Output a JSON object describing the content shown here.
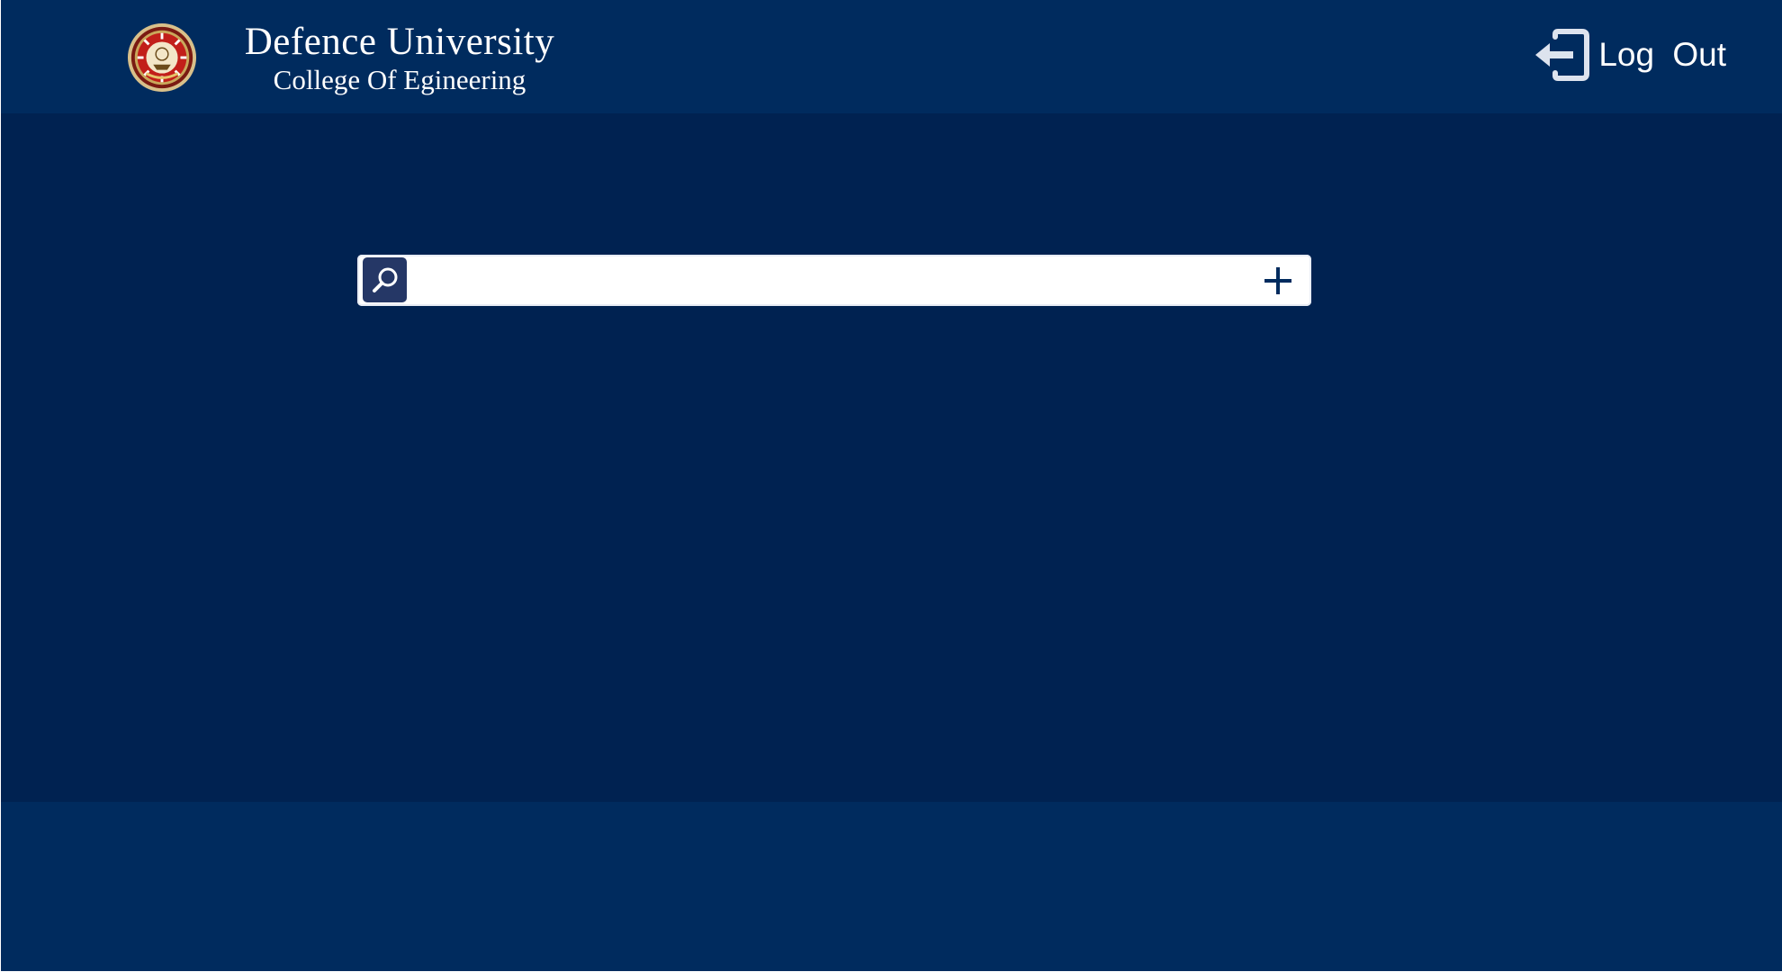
{
  "header": {
    "title": "Defence University",
    "subtitle": "College Of Egineering",
    "logo_icon": "university-seal-icon",
    "logout_label": "Log  Out",
    "logout_icon": "logout-arrow-icon"
  },
  "search": {
    "placeholder": "",
    "value": "",
    "search_icon": "search-icon",
    "add_icon": "plus-icon"
  },
  "colors": {
    "header_background": "#002b5e",
    "main_background": "#002251",
    "search_button": "#253766",
    "text": "#ffffff"
  }
}
